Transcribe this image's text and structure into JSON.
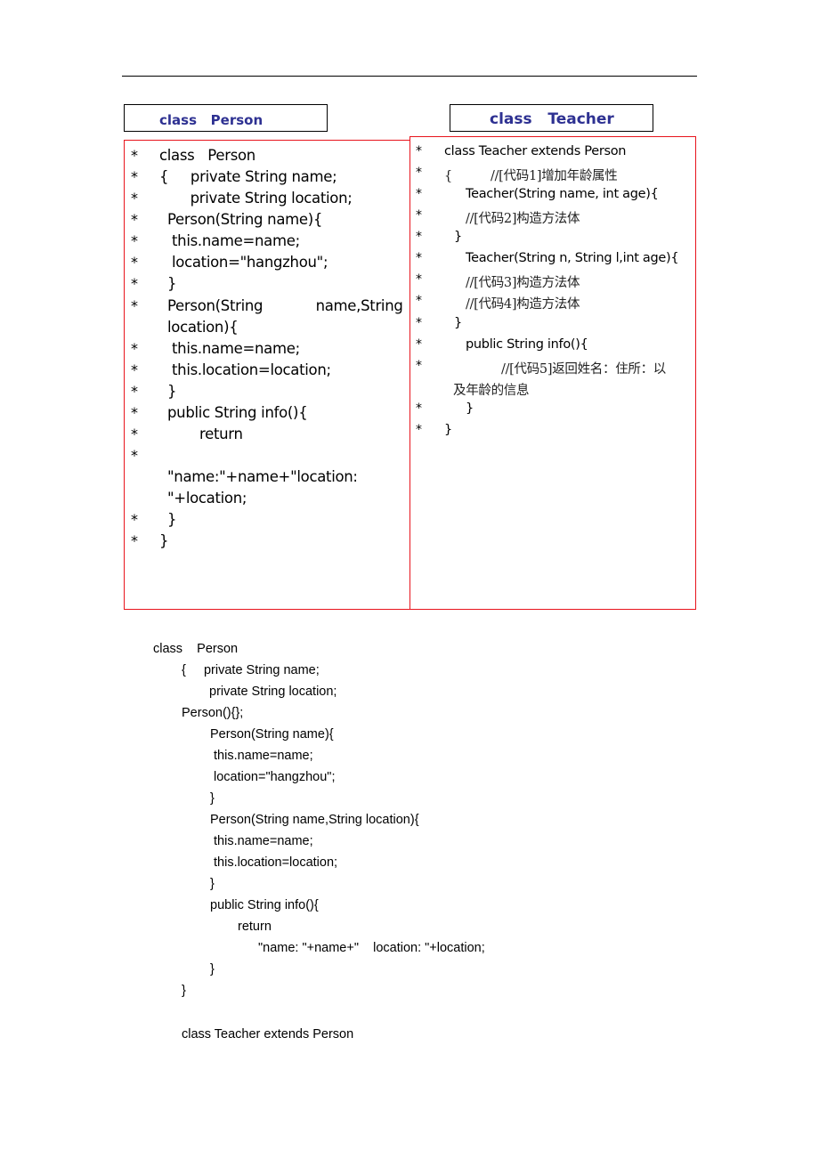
{
  "header_titles": {
    "person": "class   Person",
    "teacher": "class   Teacher"
  },
  "person_box": {
    "lines": [
      {
        "star": "*",
        "text": "class   Person"
      },
      {
        "star": "*",
        "text": "{     private String name;"
      },
      {
        "star": "*",
        "text": "       private String location;"
      },
      {
        "star": "*",
        "text": "Person(String name){"
      },
      {
        "star": "*",
        "text": "this.name=name;"
      },
      {
        "star": "*",
        "text": "location=\"hangzhou\";"
      },
      {
        "star": "*",
        "text": "}"
      },
      {
        "star": "*",
        "text": "Person(String            name,String"
      },
      {
        "star": "",
        "text": "location){"
      },
      {
        "star": "*",
        "text": "this.name=name;"
      },
      {
        "star": "*",
        "text": "this.location=location;"
      },
      {
        "star": "*",
        "text": "}"
      },
      {
        "star": "*",
        "text": "public String info(){"
      },
      {
        "star": "*",
        "text": "return"
      },
      {
        "star": "*",
        "text": ""
      },
      {
        "star": "",
        "text": "\"name:\"+name+\"location:"
      },
      {
        "star": "",
        "text": "\"+location;"
      },
      {
        "star": "*",
        "text": "}"
      },
      {
        "star": "*",
        "text": "}"
      }
    ]
  },
  "teacher_box": {
    "lines": [
      {
        "star": "*",
        "text": "class Teacher extends Person"
      },
      {
        "star": "*",
        "text": "{          //[代码1]增加年龄属性"
      },
      {
        "star": "*",
        "text": "Teacher(String name, int age){"
      },
      {
        "star": "*",
        "text": "//[代码2]构造方法体"
      },
      {
        "star": "*",
        "text": "}"
      },
      {
        "star": "*",
        "text": "Teacher(String n, String l,int age){"
      },
      {
        "star": "*",
        "text": "//[代码3]构造方法体"
      },
      {
        "star": "*",
        "text": "//[代码4]构造方法体"
      },
      {
        "star": "*",
        "text": "}"
      },
      {
        "star": "*",
        "text": "public String info(){"
      },
      {
        "star": "*",
        "text": "//[代码5]返回姓名：住所：以"
      },
      {
        "star": "",
        "text": "及年龄的信息"
      },
      {
        "star": "*",
        "text": "}"
      },
      {
        "star": "*",
        "text": "}"
      }
    ]
  },
  "plain_code": {
    "lines": [
      "class    Person",
      "{     private String name;",
      "private String location;",
      "Person(){};",
      "Person(String name){",
      "this.name=name;",
      "location=\"hangzhou\";",
      "}",
      "Person(String name,String location){",
      "this.name=name;",
      "this.location=location;",
      "}",
      "public String info(){",
      "return",
      "\"name: \"+name+\"    location: \"+location;",
      "}",
      "}",
      "class Teacher extends Person"
    ]
  }
}
